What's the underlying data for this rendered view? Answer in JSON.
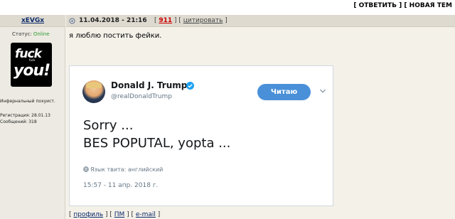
{
  "topbar": {
    "reply_label": "ОТВЕТИТЬ",
    "newtopic_label": "НОВАЯ ТЕМ"
  },
  "author": {
    "nickname": "xEVGx",
    "status_label": "Статус:",
    "status_value": "Online",
    "avatar_text_top": "fuck",
    "avatar_text_small": "fuck",
    "avatar_text_bottom": "you!",
    "rank": "Инфернальный похуист.",
    "registration": "Регистрация: 28.01.13",
    "messages": "Сообщений: 318"
  },
  "post": {
    "date": "11.04.2018 - 21:16",
    "number": "911",
    "quote_label": "цитировать",
    "text": "я люблю постить фейки."
  },
  "tweet": {
    "name": "Donald J. Trump",
    "handle": "@realDonaldTrump",
    "follow_label": "Читаю",
    "line1": "Sorry ...",
    "line2": "BES POPUTAL, yopta ...",
    "lang": "Язык твита: английский",
    "time": "15:57 - 11 апр. 2018 г.",
    "accent_color": "#4a90d9"
  },
  "footer": {
    "profile_label": "профиль",
    "pm_label": "ПМ",
    "email_label": "e-mail"
  }
}
